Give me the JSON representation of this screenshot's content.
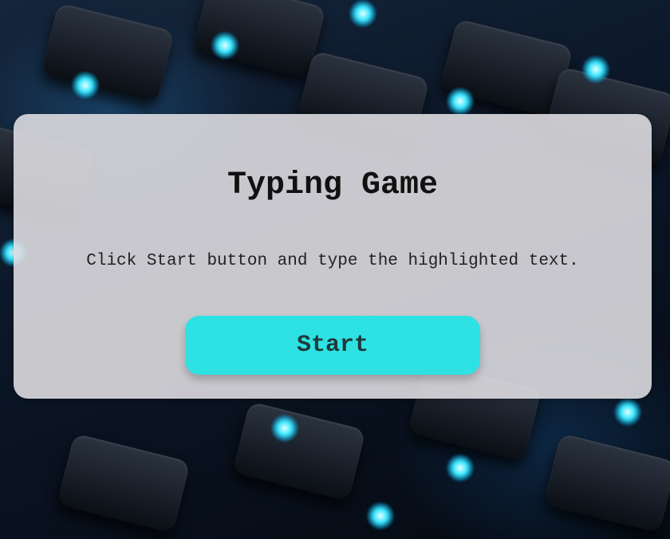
{
  "game": {
    "title": "Typing Game",
    "instructions": "Click Start button and type the highlighted text.",
    "start_label": "Start"
  },
  "theme": {
    "button_color": "#2ee2e4",
    "card_color": "#dddbe0",
    "accent_glow": "#38e6ff"
  }
}
